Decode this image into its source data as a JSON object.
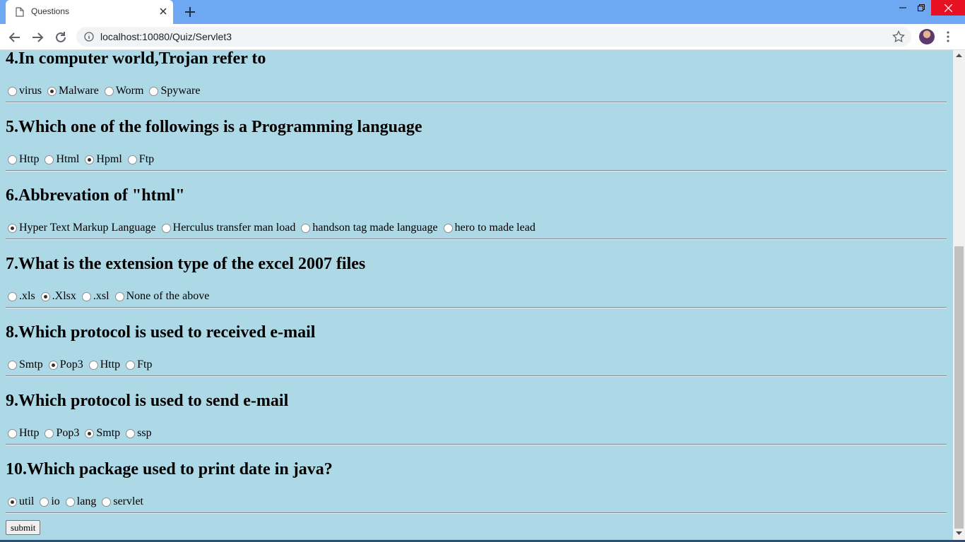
{
  "browser": {
    "tab_title": "Questions",
    "url": "localhost:10080/Quiz/Servlet3"
  },
  "questions": [
    {
      "title": "4.In computer world,Trojan refer to",
      "options": [
        "virus",
        "Malware",
        "Worm",
        "Spyware"
      ],
      "selected": 1
    },
    {
      "title": "5.Which one of the followings is a Programming language",
      "options": [
        "Http",
        "Html",
        "Hpml",
        "Ftp"
      ],
      "selected": 2
    },
    {
      "title": "6.Abbrevation of \"html\"",
      "options": [
        "Hyper Text Markup Language",
        "Herculus transfer man load",
        "handson tag made language",
        "hero to made lead"
      ],
      "selected": 0
    },
    {
      "title": "7.What is the extension type of the excel 2007 files",
      "options": [
        ".xls",
        ".Xlsx",
        ".xsl",
        "None of the above"
      ],
      "selected": 1
    },
    {
      "title": "8.Which protocol is used to received e-mail",
      "options": [
        "Smtp",
        "Pop3",
        "Http",
        "Ftp"
      ],
      "selected": 1
    },
    {
      "title": "9.Which protocol is used to send e-mail",
      "options": [
        "Http",
        "Pop3",
        "Smtp",
        "ssp"
      ],
      "selected": 2
    },
    {
      "title": "10.Which package used to print date in java?",
      "options": [
        "util",
        "io",
        "lang",
        "servlet"
      ],
      "selected": 0
    }
  ],
  "submit_label": "submit"
}
